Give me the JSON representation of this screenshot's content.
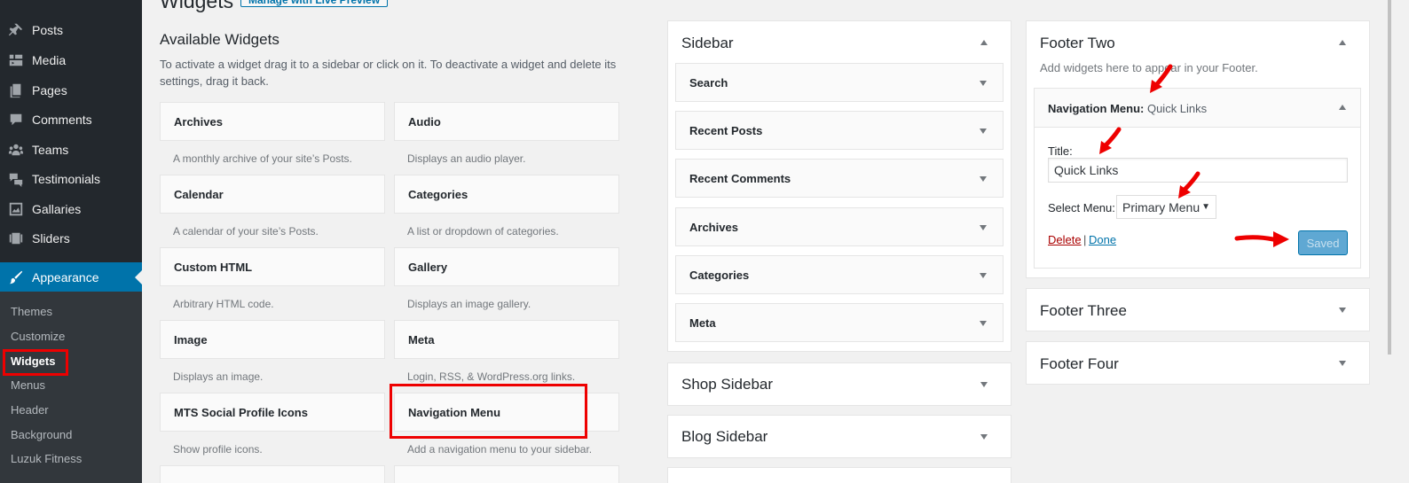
{
  "page": {
    "title": "Widgets",
    "live_preview_label": "Manage with Live Preview"
  },
  "admin_menu": {
    "items": [
      {
        "label": "Posts",
        "icon": "pin-icon"
      },
      {
        "label": "Media",
        "icon": "media-icon"
      },
      {
        "label": "Pages",
        "icon": "pages-icon"
      },
      {
        "label": "Comments",
        "icon": "comments-icon"
      },
      {
        "label": "Teams",
        "icon": "groups-icon"
      },
      {
        "label": "Testimonials",
        "icon": "testimonial-icon"
      },
      {
        "label": "Gallaries",
        "icon": "gallery-icon"
      },
      {
        "label": "Sliders",
        "icon": "slides-icon"
      },
      {
        "label": "Appearance",
        "icon": "paintbrush-icon"
      }
    ],
    "submenu": [
      "Themes",
      "Customize",
      "Widgets",
      "Menus",
      "Header",
      "Background",
      "Luzuk Fitness"
    ]
  },
  "available": {
    "title": "Available Widgets",
    "description": "To activate a widget drag it to a sidebar or click on it. To deactivate a widget and delete its settings, drag it back.",
    "widgets": [
      {
        "name": "Archives",
        "desc": "A monthly archive of your site’s Posts."
      },
      {
        "name": "Audio",
        "desc": "Displays an audio player."
      },
      {
        "name": "Calendar",
        "desc": "A calendar of your site’s Posts."
      },
      {
        "name": "Categories",
        "desc": "A list or dropdown of categories."
      },
      {
        "name": "Custom HTML",
        "desc": "Arbitrary HTML code."
      },
      {
        "name": "Gallery",
        "desc": "Displays an image gallery."
      },
      {
        "name": "Image",
        "desc": "Displays an image."
      },
      {
        "name": "Meta",
        "desc": "Login, RSS, & WordPress.org links."
      },
      {
        "name": "MTS Social Profile Icons",
        "desc": "Show profile icons."
      },
      {
        "name": "Navigation Menu",
        "desc": "Add a navigation menu to your sidebar."
      }
    ]
  },
  "sidebar": {
    "title": "Sidebar",
    "widgets": [
      "Search",
      "Recent Posts",
      "Recent Comments",
      "Archives",
      "Categories",
      "Meta"
    ]
  },
  "collapsed_sidebars": [
    "Shop Sidebar",
    "Blog Sidebar"
  ],
  "footer_two": {
    "title": "Footer Two",
    "description": "Add widgets here to appear in your Footer.",
    "widget": {
      "name": "Navigation Menu:",
      "instance_title": "Quick Links",
      "title_label": "Title:",
      "title_value": "Quick Links",
      "select_label": "Select Menu:",
      "select_value": "Primary Menu",
      "delete_label": "Delete",
      "separator": "|",
      "done_label": "Done",
      "save_label": "Saved"
    }
  },
  "other_footers": [
    "Footer Three",
    "Footer Four"
  ],
  "colors": {
    "accent": "#0073aa",
    "admin_bg": "#23282d",
    "highlight": "#ee0000"
  }
}
